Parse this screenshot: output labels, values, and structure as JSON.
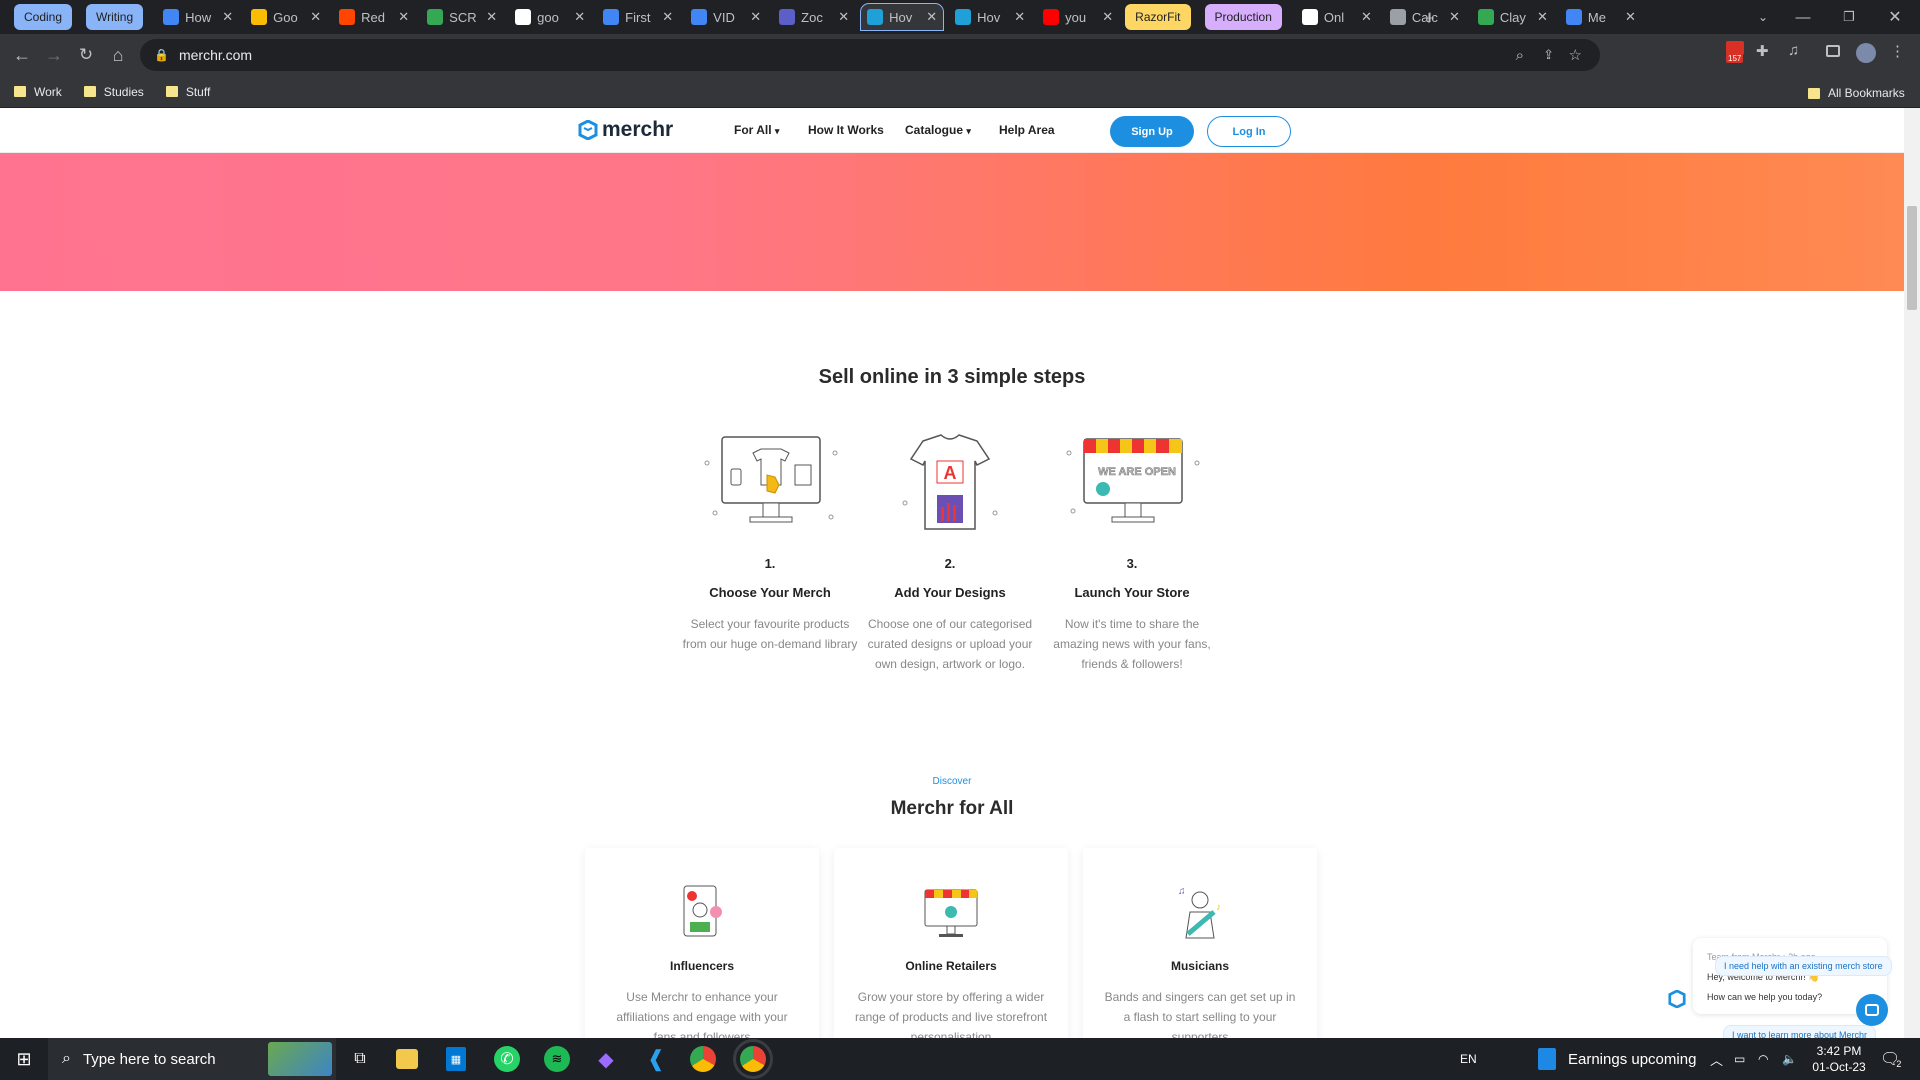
{
  "browser": {
    "tabs": [
      {
        "label": "Coding",
        "kind": "group",
        "color": "#8ab4f8"
      },
      {
        "label": "Writing",
        "kind": "group",
        "color": "#8ab4f8"
      },
      {
        "label": "How",
        "favicon": "#4285f4"
      },
      {
        "label": "Goo",
        "favicon": "#fbbc04"
      },
      {
        "label": "Red",
        "favicon": "#ff4500"
      },
      {
        "label": "SCR",
        "favicon": "#34a853"
      },
      {
        "label": "goo",
        "favicon": "#ffffff"
      },
      {
        "label": "First",
        "favicon": "#4285f4"
      },
      {
        "label": "VID",
        "favicon": "#4285f4"
      },
      {
        "label": "Zoc",
        "favicon": "#5b5fc7"
      },
      {
        "label": "Hov",
        "favicon": "#1fa0d8",
        "active": true
      },
      {
        "label": "Hov",
        "favicon": "#1fa0d8"
      },
      {
        "label": "you",
        "favicon": "#ff0000"
      },
      {
        "label": "RazorFit",
        "kind": "group",
        "color": "#fdd663"
      },
      {
        "label": "Production",
        "kind": "group",
        "color": "#d7aefb"
      },
      {
        "label": "Onl",
        "favicon": "#ffffff"
      },
      {
        "label": "Calc",
        "favicon": "#9aa0a6"
      },
      {
        "label": "Clay",
        "favicon": "#34a853"
      },
      {
        "label": "Me",
        "favicon": "#4285f4"
      }
    ],
    "url": "merchr.com",
    "extension_badge": "157",
    "bookmarks": [
      "Work",
      "Studies",
      "Stuff"
    ],
    "all_bookmarks": "All Bookmarks"
  },
  "site": {
    "logo": "merchr",
    "nav": {
      "for_all": "For All",
      "how_it_works": "How It Works",
      "catalogue": "Catalogue",
      "help": "Help Area",
      "signup": "Sign Up",
      "login": "Log In"
    },
    "steps_title": "Sell online in 3 simple steps",
    "steps": [
      {
        "num": "1.",
        "title": "Choose Your Merch",
        "desc": "Select your favourite products from our huge on-demand library"
      },
      {
        "num": "2.",
        "title": "Add Your Designs",
        "desc": "Choose one of our categorised curated designs or upload your own design, artwork or logo."
      },
      {
        "num": "3.",
        "title": "Launch Your Store",
        "desc": "Now it's time to share the amazing news with your fans, friends & followers!"
      }
    ],
    "store_sign": "WE ARE OPEN",
    "design_letter": "A",
    "discover_label": "Discover",
    "for_all_title": "Merchr for All",
    "cards": [
      {
        "title": "Influencers",
        "desc": "Use Merchr to enhance your affiliations and engage with your fans and followers"
      },
      {
        "title": "Online Retailers",
        "desc": "Grow your store by offering a wider range of products and live storefront personalisation"
      },
      {
        "title": "Musicians",
        "desc": "Bands and singers can get set up in a flash to start selling to your supporters"
      }
    ],
    "chat": {
      "meta": "Team from Merchr • 2h ago",
      "line1": "Hey, welcome to Merchr! 👋",
      "line2": "How can we help you today?",
      "reply1": "I want to learn more about Merchr",
      "reply2": "I need help with an existing merch store"
    }
  },
  "taskbar": {
    "search_placeholder": "Type here to search",
    "lang": "EN",
    "news": "Earnings upcoming",
    "time": "3:42 PM",
    "date": "01-Oct-23",
    "notif_count": "2"
  },
  "colors": {
    "accent": "#1d8fe0",
    "hero_left": "#ff7390",
    "hero_right": "#ff7a3d"
  }
}
